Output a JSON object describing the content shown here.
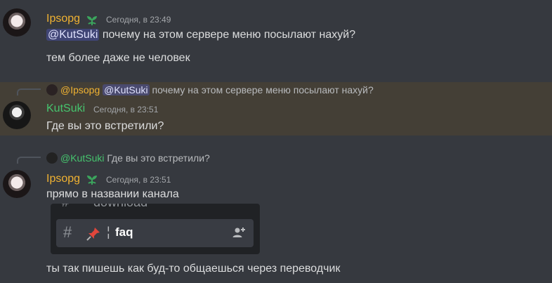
{
  "messages": [
    {
      "author": "Ipsopg",
      "timestamp": "Сегодня, в 23:49",
      "mention": "@KutSuki",
      "line1": "почему на этом сервере меню посылают нахуй?",
      "line2": "тем более даже не человек"
    },
    {
      "reply": {
        "author": "@Ipsopg",
        "mention": "@KutSuki",
        "text": "почему на этом сервере меню посылают нахуй?"
      },
      "author": "KutSuki",
      "timestamp": "Сегодня, в 23:51",
      "text": "Где вы это встретили?"
    },
    {
      "reply": {
        "author": "@KutSuki",
        "text": "Где вы это встретили?"
      },
      "author": "Ipsopg",
      "timestamp": "Сегодня, в 23:51",
      "text": "прямо в названии канала",
      "embed": {
        "top_channel": "download",
        "channel": "faq"
      },
      "after": "ты так пишешь как буд-то общаешься через переводчик"
    }
  ],
  "colors": {
    "background": "#36393f",
    "highlight": "#443f36",
    "author_yellow": "#f0b232",
    "author_green": "#46c46e",
    "mention_bg": "#4e5694"
  },
  "icons": [
    "sprout-badge-icon",
    "hash-icon",
    "pin-icon",
    "add-member-icon"
  ]
}
